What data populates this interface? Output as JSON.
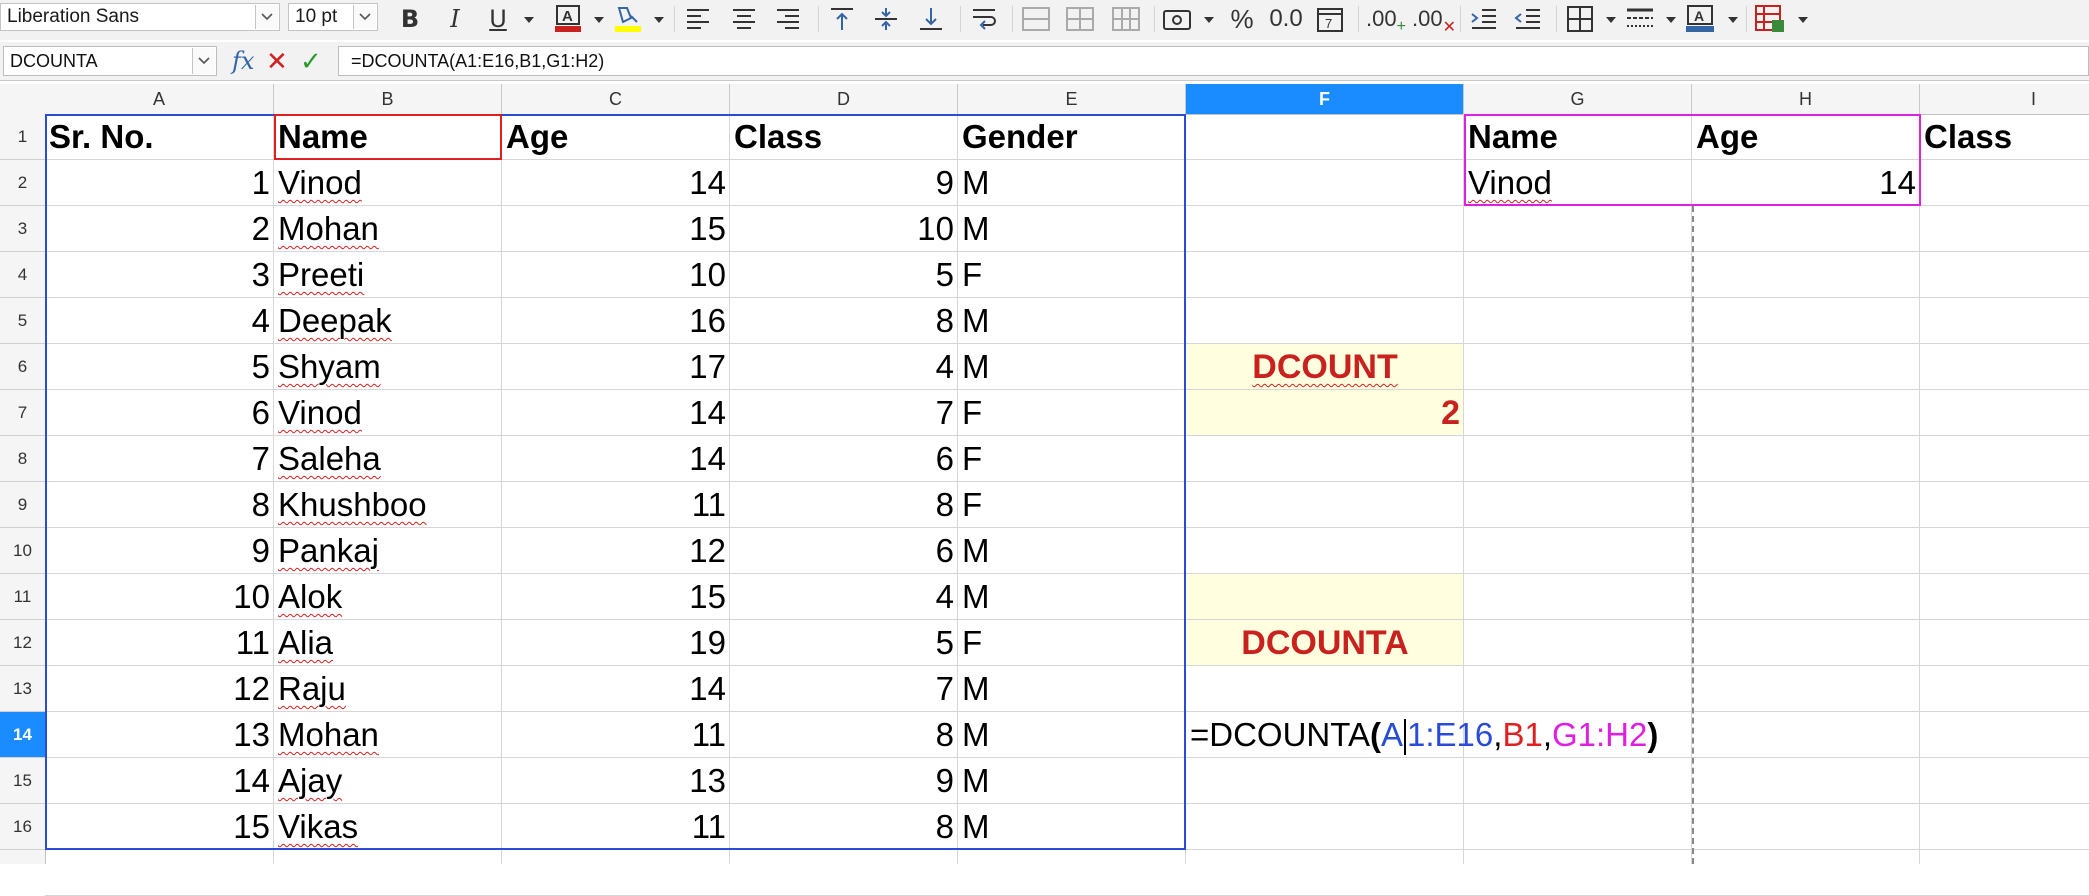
{
  "toolbar": {
    "font_name": "Liberation Sans",
    "font_size": "10 pt",
    "icons": [
      "bold-icon",
      "italic-icon",
      "underline-icon",
      "font-color-icon",
      "highlight-icon",
      "align-left-icon",
      "align-center-icon",
      "align-right-icon",
      "align-top-icon",
      "align-middle-icon",
      "align-bottom-icon",
      "wrap-text-icon",
      "merge-cells-icon",
      "unmerge-cells-icon",
      "merge-center-icon",
      "currency-icon",
      "percent-icon",
      "number-format-icon",
      "date-format-icon",
      "add-decimal-icon",
      "delete-decimal-icon",
      "increase-indent-icon",
      "decrease-indent-icon",
      "borders-icon",
      "border-style-icon",
      "border-color-icon",
      "conditional-format-icon"
    ],
    "colors": {
      "font_color": "#c9211e",
      "highlight": "#ffff00",
      "accent_blue": "#1a8cff"
    }
  },
  "formula_bar": {
    "name_box": "DCOUNTA",
    "fx_label": "fx",
    "cancel_label": "✕",
    "accept_label": "✓",
    "formula": "=DCOUNTA(A1:E16,B1,G1:H2)"
  },
  "columns": [
    "A",
    "B",
    "C",
    "D",
    "E",
    "F",
    "G",
    "H",
    "I"
  ],
  "selected_column": "F",
  "rows": [
    "1",
    "2",
    "3",
    "4",
    "5",
    "6",
    "7",
    "8",
    "9",
    "10",
    "11",
    "12",
    "13",
    "14",
    "15",
    "16"
  ],
  "selected_row": "14",
  "table": {
    "headers": [
      "Sr. No.",
      "Name",
      "Age",
      "Class",
      "Gender"
    ],
    "rows": [
      [
        "1",
        "Vinod",
        "14",
        "9",
        "M"
      ],
      [
        "2",
        "Mohan",
        "15",
        "10",
        "M"
      ],
      [
        "3",
        "Preeti",
        "10",
        "5",
        "F"
      ],
      [
        "4",
        "Deepak",
        "16",
        "8",
        "M"
      ],
      [
        "5",
        "Shyam",
        "17",
        "4",
        "M"
      ],
      [
        "6",
        "Vinod",
        "14",
        "7",
        "F"
      ],
      [
        "7",
        "Saleha",
        "14",
        "6",
        "F"
      ],
      [
        "8",
        "Khushboo",
        "11",
        "8",
        "F"
      ],
      [
        "9",
        "Pankaj",
        "12",
        "6",
        "M"
      ],
      [
        "10",
        "Alok",
        "15",
        "4",
        "M"
      ],
      [
        "11",
        "Alia",
        "19",
        "5",
        "F"
      ],
      [
        "12",
        "Raju",
        "14",
        "7",
        "M"
      ],
      [
        "13",
        "Mohan",
        "11",
        "8",
        "M"
      ],
      [
        "14",
        "Ajay",
        "13",
        "9",
        "M"
      ],
      [
        "15",
        "Vikas",
        "11",
        "8",
        "M"
      ]
    ]
  },
  "criteria": {
    "headers": [
      "Name",
      "Age",
      "Class"
    ],
    "values": [
      "Vinod",
      "14"
    ]
  },
  "dcount": {
    "label": "DCOUNT",
    "result": "2"
  },
  "dcounta": {
    "label": "DCOUNTA"
  },
  "editing_cell": {
    "prefix": "=DCOUNTA",
    "open": "(",
    "range1_a": "A",
    "range1_b": "1:E16",
    "comma1": ",",
    "arg2": "B1",
    "comma2": ",",
    "arg3": "G1:H2",
    "close": ")",
    "colors": {
      "range1": "#2a4bd7",
      "arg2": "#e02020",
      "arg3": "#e020e0"
    }
  }
}
